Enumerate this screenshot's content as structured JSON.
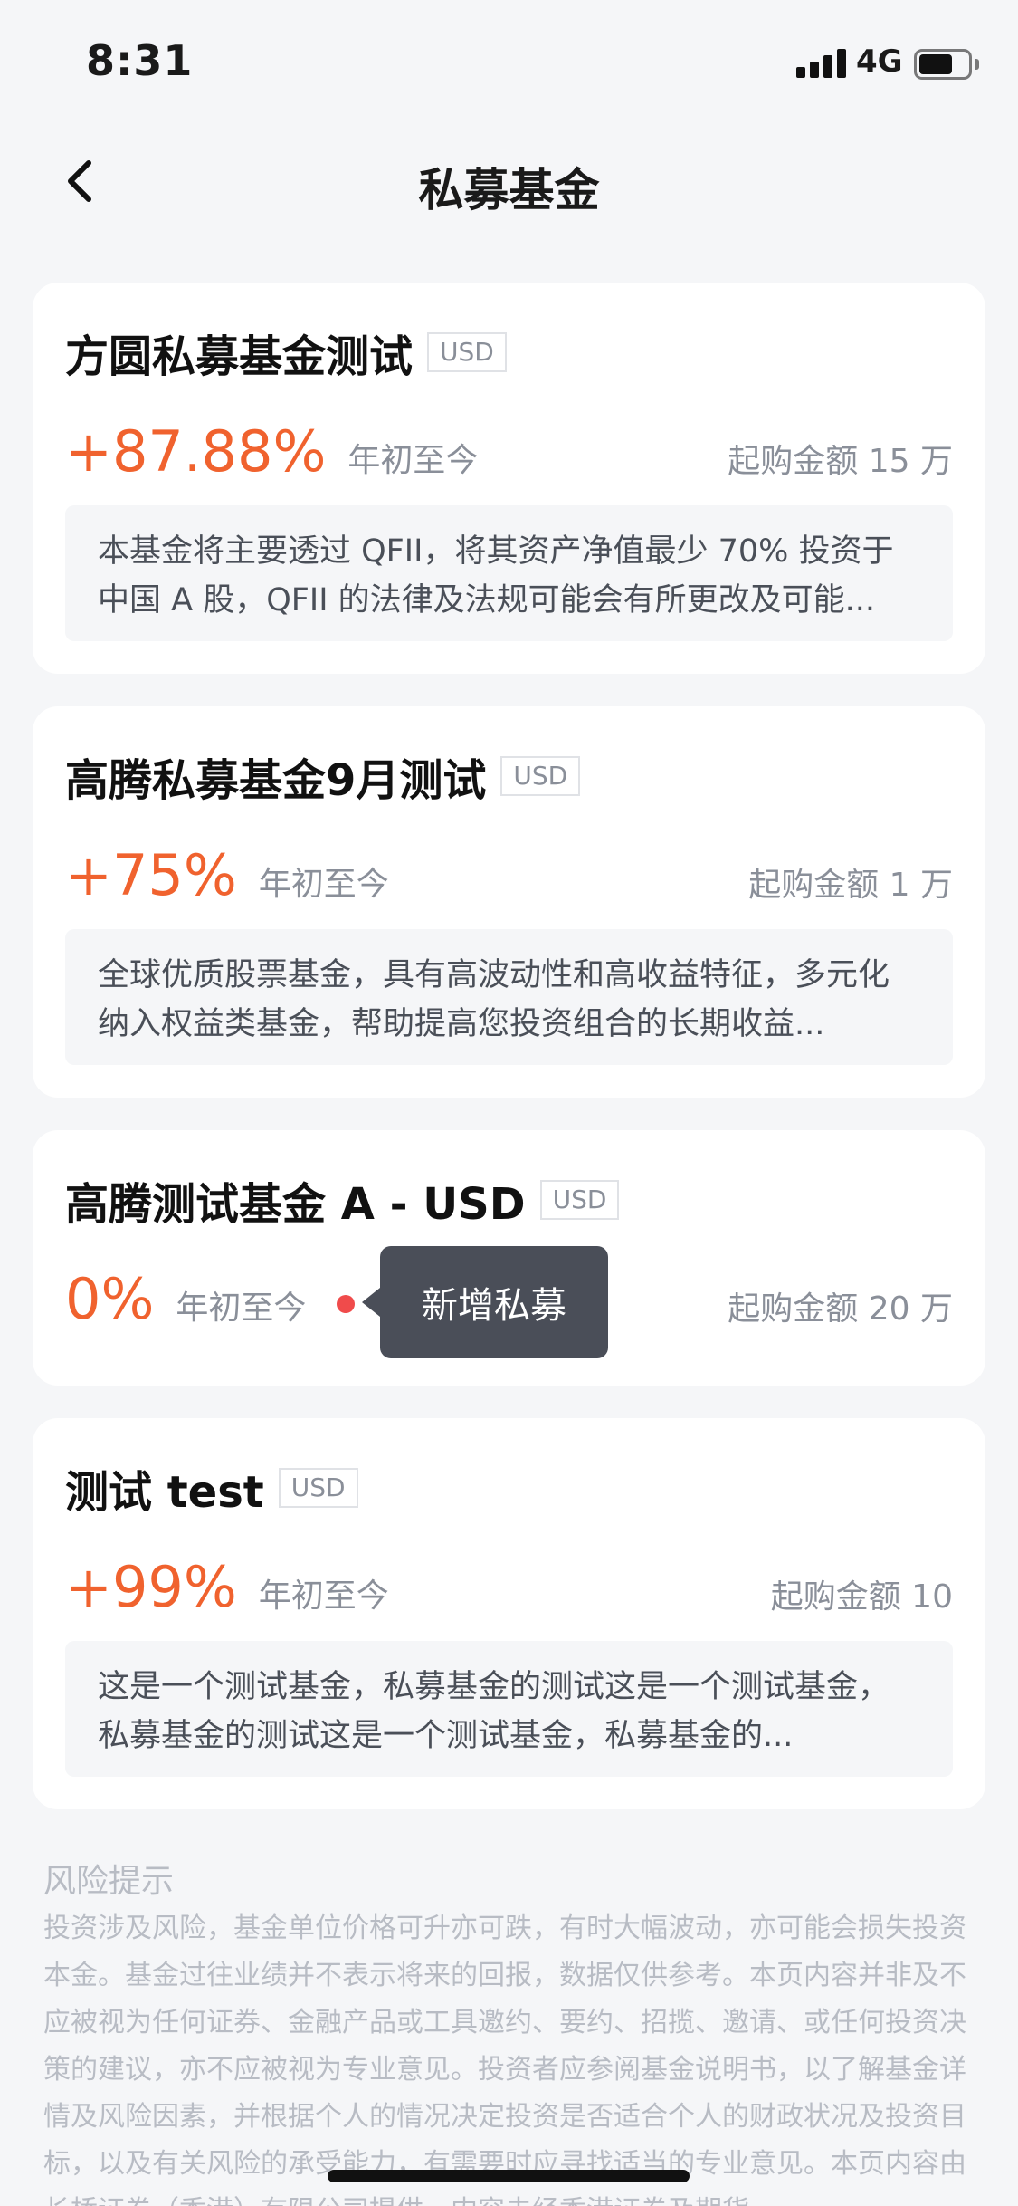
{
  "status_bar": {
    "time": "8:31",
    "network": "4G",
    "battery_level": 0.7
  },
  "nav": {
    "title": "私募基金"
  },
  "funds": [
    {
      "name": "方圆私募基金测试",
      "currency": "USD",
      "return": "+87.88%",
      "period": "年初至今",
      "min_amount": "起购金额 15 万",
      "description": "本基金将主要透过 QFII，将其资产净值最少 70% 投资于中国 A 股，QFII 的法律及法规可能会有所更改及可能..."
    },
    {
      "name": "高腾私募基金9月测试",
      "currency": "USD",
      "return": "+75%",
      "period": "年初至今",
      "min_amount": "起购金额 1 万",
      "description": "全球优质股票基金，具有高波动性和高收益特征，多元化纳入权益类基金，帮助提高您投资组合的长期收益..."
    },
    {
      "name": "高腾测试基金 A - USD",
      "currency": "USD",
      "return": "0%",
      "period": "年初至今",
      "min_amount": "起购金额 20 万"
    },
    {
      "name": "测试 test",
      "currency": "USD",
      "return": "+99%",
      "period": "年初至今",
      "min_amount": "起购金额 10",
      "description": "这是一个测试基金，私募基金的测试这是一个测试基金，私募基金的测试这是一个测试基金，私募基金的..."
    }
  ],
  "tooltip": {
    "text": "新增私募"
  },
  "risk": {
    "title": "风险提示",
    "text": "投资涉及风险，基金单位价格可升亦可跌，有时大幅波动，亦可能会损失投资本金。基金过往业绩并不表示将来的回报，数据仅供参考。本页内容并非及不应被视为任何证券、金融产品或工具邀约、要约、招揽、邀请、或任何投资决策的建议，亦不应被视为专业意见。投资者应参阅基金说明书，以了解基金详情及风险因素，并根据个人的情况决定投资是否适合个人的财政状况及投资目标，以及有关风险的承受能力，有需要时应寻找适当的专业意见。本页内容由长桥证券（香港）有限公司提供，内容未经香港证券及期货"
  },
  "colors": {
    "accent": "#f0622e",
    "background": "#f5f6f8",
    "tooltip_bg": "#4a4e58",
    "dot": "#f04b4b"
  }
}
